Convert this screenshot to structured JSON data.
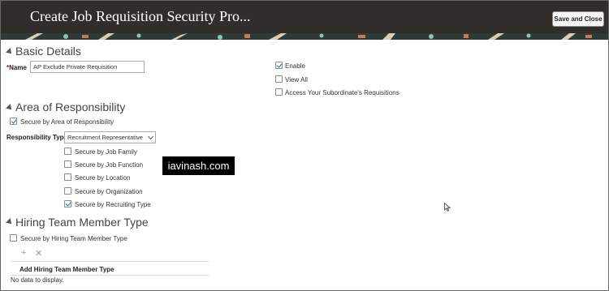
{
  "header": {
    "title": "Create Job Requisition Security Pro...",
    "save_close_label": "Save and Close"
  },
  "basic_details": {
    "title": "Basic Details",
    "name_label": "Name",
    "required_mark": "*",
    "name_value": "AP Exclude Private Requisition",
    "enable_label": "Enable",
    "enable_checked": true,
    "view_all_label": "View All",
    "view_all_checked": false,
    "subordinate_label": "Access Your Subordinate's Requisitions",
    "subordinate_checked": false
  },
  "area_of_responsibility": {
    "title": "Area of Responsibility",
    "secure_by_aor_label": "Secure by Area of Responsibility",
    "secure_by_aor_checked": true,
    "responsibility_type_label": "Responsibility Type",
    "responsibility_type_value": "Recruitment Representative",
    "options": [
      {
        "label": "Secure by Job Family",
        "checked": false
      },
      {
        "label": "Secure by Job Function",
        "checked": false
      },
      {
        "label": "Secure by Location",
        "checked": false
      },
      {
        "label": "Secure by Organization",
        "checked": false
      },
      {
        "label": "Secure by Recruiting Type",
        "checked": true
      }
    ]
  },
  "watermark": {
    "text": "iavinash.com"
  },
  "hiring_team": {
    "title": "Hiring Team Member Type",
    "secure_by_label": "Secure by Hiring Team Member Type",
    "secure_by_checked": false,
    "add_icon": "plus-icon",
    "remove_icon": "x-icon",
    "column_header": "Add Hiring Team Member Type",
    "empty_text": "No data to display."
  },
  "colors": {
    "header_bg": "#312d2a",
    "accent_check": "#1f6fb2"
  }
}
